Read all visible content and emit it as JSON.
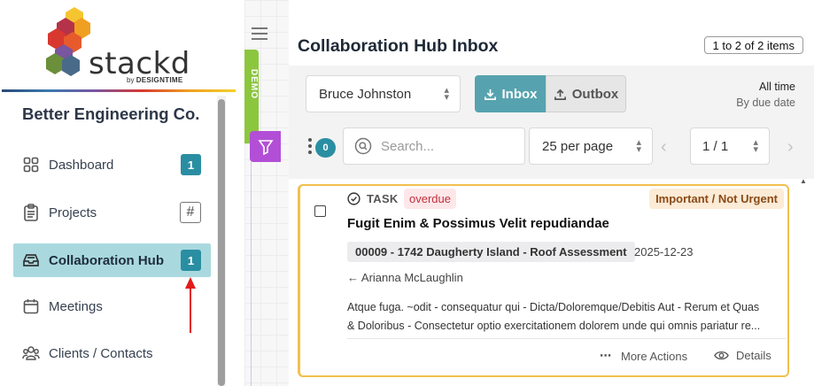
{
  "brand": {
    "name": "stackd",
    "byline_prefix": "by",
    "byline_brand": "DESIGNTIME"
  },
  "sidebar": {
    "company": "Better Engineering Co.",
    "items": [
      {
        "label": "Dashboard",
        "icon": "grid-icon",
        "badge": "1"
      },
      {
        "label": "Projects",
        "icon": "clipboard-icon",
        "badge": "#"
      },
      {
        "label": "Collaboration Hub",
        "icon": "inbox-tray-icon",
        "badge": "1",
        "active": true
      },
      {
        "label": "Meetings",
        "icon": "calendar-icon"
      },
      {
        "label": "Clients / Contacts",
        "icon": "people-icon"
      }
    ]
  },
  "demo_tab": "DEMO",
  "header": {
    "title": "Collaboration Hub Inbox",
    "item_count": "1 to 2 of 2 items"
  },
  "filters": {
    "user": "Bruce Johnston",
    "inbox_label": "Inbox",
    "outbox_label": "Outbox",
    "time_range": "All time",
    "sort": "By due date"
  },
  "toolbar": {
    "selected_count": "0",
    "search_placeholder": "Search...",
    "per_page": "25 per page",
    "page": "1 / 1"
  },
  "task": {
    "type": "TASK",
    "status": "overdue",
    "priority": "Important / Not Urgent",
    "title": "Fugit Enim & Possimus Velit repudiandae",
    "project": "00009 - 1742 Daugherty Island - Roof Assessment",
    "due_date": "2025-12-23",
    "assignee": "← Arianna McLaughlin",
    "description_line1": "Atque fuga. ~odit - consequatur qui - Dicta/Doloremque/Debitis Aut - Rerum et Quas",
    "description_line2": "& Doloribus - Consectetur optio exercitationem dolorem unde qui omnis pariatur re...",
    "more_actions": "More Actions",
    "details": "Details"
  },
  "colors": {
    "teal_badge": "#2a8ea3",
    "active_nav_bg": "#a9d9df",
    "inbox_button": "#56a3af",
    "card_border": "#f2c04e",
    "demo_tab": "#8cc63f",
    "filter_tab": "#b24fd6",
    "overdue_text": "#c0303d"
  }
}
